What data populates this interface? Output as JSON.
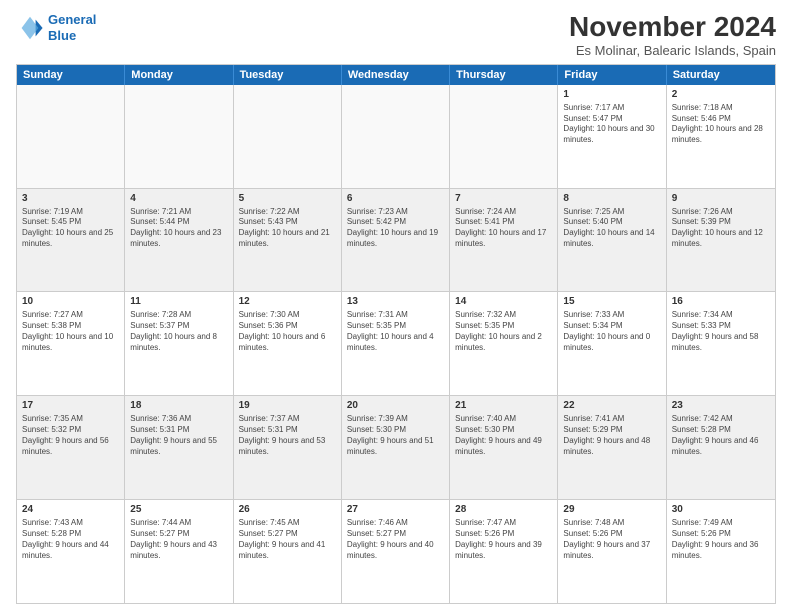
{
  "logo": {
    "line1": "General",
    "line2": "Blue"
  },
  "title": "November 2024",
  "location": "Es Molinar, Balearic Islands, Spain",
  "days": [
    "Sunday",
    "Monday",
    "Tuesday",
    "Wednesday",
    "Thursday",
    "Friday",
    "Saturday"
  ],
  "rows": [
    [
      {
        "day": "",
        "empty": true
      },
      {
        "day": "",
        "empty": true
      },
      {
        "day": "",
        "empty": true
      },
      {
        "day": "",
        "empty": true
      },
      {
        "day": "",
        "empty": true
      },
      {
        "day": "1",
        "text": "Sunrise: 7:17 AM\nSunset: 5:47 PM\nDaylight: 10 hours and 30 minutes."
      },
      {
        "day": "2",
        "text": "Sunrise: 7:18 AM\nSunset: 5:46 PM\nDaylight: 10 hours and 28 minutes."
      }
    ],
    [
      {
        "day": "3",
        "text": "Sunrise: 7:19 AM\nSunset: 5:45 PM\nDaylight: 10 hours and 25 minutes."
      },
      {
        "day": "4",
        "text": "Sunrise: 7:21 AM\nSunset: 5:44 PM\nDaylight: 10 hours and 23 minutes."
      },
      {
        "day": "5",
        "text": "Sunrise: 7:22 AM\nSunset: 5:43 PM\nDaylight: 10 hours and 21 minutes."
      },
      {
        "day": "6",
        "text": "Sunrise: 7:23 AM\nSunset: 5:42 PM\nDaylight: 10 hours and 19 minutes."
      },
      {
        "day": "7",
        "text": "Sunrise: 7:24 AM\nSunset: 5:41 PM\nDaylight: 10 hours and 17 minutes."
      },
      {
        "day": "8",
        "text": "Sunrise: 7:25 AM\nSunset: 5:40 PM\nDaylight: 10 hours and 14 minutes."
      },
      {
        "day": "9",
        "text": "Sunrise: 7:26 AM\nSunset: 5:39 PM\nDaylight: 10 hours and 12 minutes."
      }
    ],
    [
      {
        "day": "10",
        "text": "Sunrise: 7:27 AM\nSunset: 5:38 PM\nDaylight: 10 hours and 10 minutes."
      },
      {
        "day": "11",
        "text": "Sunrise: 7:28 AM\nSunset: 5:37 PM\nDaylight: 10 hours and 8 minutes."
      },
      {
        "day": "12",
        "text": "Sunrise: 7:30 AM\nSunset: 5:36 PM\nDaylight: 10 hours and 6 minutes."
      },
      {
        "day": "13",
        "text": "Sunrise: 7:31 AM\nSunset: 5:35 PM\nDaylight: 10 hours and 4 minutes."
      },
      {
        "day": "14",
        "text": "Sunrise: 7:32 AM\nSunset: 5:35 PM\nDaylight: 10 hours and 2 minutes."
      },
      {
        "day": "15",
        "text": "Sunrise: 7:33 AM\nSunset: 5:34 PM\nDaylight: 10 hours and 0 minutes."
      },
      {
        "day": "16",
        "text": "Sunrise: 7:34 AM\nSunset: 5:33 PM\nDaylight: 9 hours and 58 minutes."
      }
    ],
    [
      {
        "day": "17",
        "text": "Sunrise: 7:35 AM\nSunset: 5:32 PM\nDaylight: 9 hours and 56 minutes."
      },
      {
        "day": "18",
        "text": "Sunrise: 7:36 AM\nSunset: 5:31 PM\nDaylight: 9 hours and 55 minutes."
      },
      {
        "day": "19",
        "text": "Sunrise: 7:37 AM\nSunset: 5:31 PM\nDaylight: 9 hours and 53 minutes."
      },
      {
        "day": "20",
        "text": "Sunrise: 7:39 AM\nSunset: 5:30 PM\nDaylight: 9 hours and 51 minutes."
      },
      {
        "day": "21",
        "text": "Sunrise: 7:40 AM\nSunset: 5:30 PM\nDaylight: 9 hours and 49 minutes."
      },
      {
        "day": "22",
        "text": "Sunrise: 7:41 AM\nSunset: 5:29 PM\nDaylight: 9 hours and 48 minutes."
      },
      {
        "day": "23",
        "text": "Sunrise: 7:42 AM\nSunset: 5:28 PM\nDaylight: 9 hours and 46 minutes."
      }
    ],
    [
      {
        "day": "24",
        "text": "Sunrise: 7:43 AM\nSunset: 5:28 PM\nDaylight: 9 hours and 44 minutes."
      },
      {
        "day": "25",
        "text": "Sunrise: 7:44 AM\nSunset: 5:27 PM\nDaylight: 9 hours and 43 minutes."
      },
      {
        "day": "26",
        "text": "Sunrise: 7:45 AM\nSunset: 5:27 PM\nDaylight: 9 hours and 41 minutes."
      },
      {
        "day": "27",
        "text": "Sunrise: 7:46 AM\nSunset: 5:27 PM\nDaylight: 9 hours and 40 minutes."
      },
      {
        "day": "28",
        "text": "Sunrise: 7:47 AM\nSunset: 5:26 PM\nDaylight: 9 hours and 39 minutes."
      },
      {
        "day": "29",
        "text": "Sunrise: 7:48 AM\nSunset: 5:26 PM\nDaylight: 9 hours and 37 minutes."
      },
      {
        "day": "30",
        "text": "Sunrise: 7:49 AM\nSunset: 5:26 PM\nDaylight: 9 hours and 36 minutes."
      }
    ]
  ]
}
